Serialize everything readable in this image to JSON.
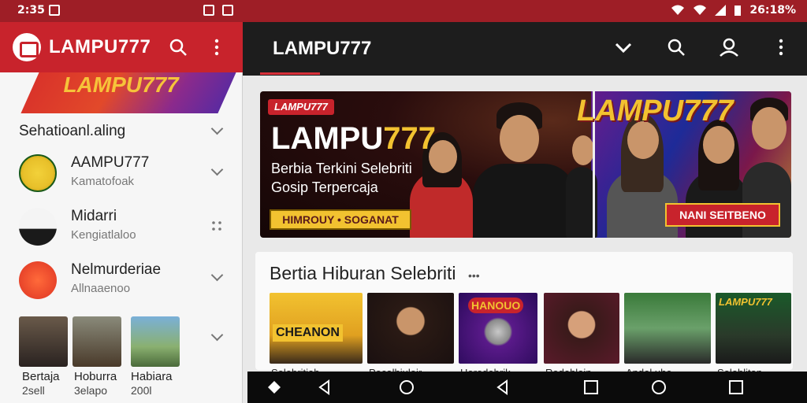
{
  "status": {
    "time": "2:35",
    "battery": "26:18%"
  },
  "drawer": {
    "title": "LAMPU777",
    "banner_logo": "LAMPU777",
    "section_label": "Sehatioanl.aling",
    "items": [
      {
        "title": "AAMPU777",
        "subtitle": "Kamatofoak"
      },
      {
        "title": "Midarri",
        "subtitle": "Kengiatlaloo"
      },
      {
        "title": "Nelmurderiae",
        "subtitle": "Allnaaenoo"
      }
    ],
    "thumbs": [
      {
        "label": "Bertaja",
        "sub": "2sell"
      },
      {
        "label": "Hoburra",
        "sub": "3elapo"
      },
      {
        "label": "Habiara",
        "sub": "200l"
      }
    ]
  },
  "topbar": {
    "title": "LAMPU777"
  },
  "hero": {
    "pill": "LAMPU777",
    "headline_a": "LAMPU",
    "headline_b": "777",
    "line1": "Berbia Terkini Selebriti",
    "line2": "Gosip  Terpercaja",
    "cta_left": "HIMROUY • SOGANAT",
    "right_logo": "LAMPU777",
    "cta_right": "NANI SEITBENO"
  },
  "section": {
    "heading": "Bertia Hiburan Selebriti",
    "more": "•••",
    "tiles": [
      {
        "badge": "CHEANON",
        "caption": "Selebritiab..."
      },
      {
        "badge": "",
        "caption": "Pecalhiuloir..."
      },
      {
        "badge": "HANOUO",
        "caption": "Horedebrik..."
      },
      {
        "badge": "",
        "caption": "Redeblain..."
      },
      {
        "badge": "",
        "caption": "Andel uhe..."
      },
      {
        "badge": "LAMPU777",
        "caption": "Seleblitan..."
      }
    ]
  },
  "colors": {
    "brand_red": "#c8232c",
    "status_red": "#9e1e26",
    "gold": "#f2c230"
  }
}
